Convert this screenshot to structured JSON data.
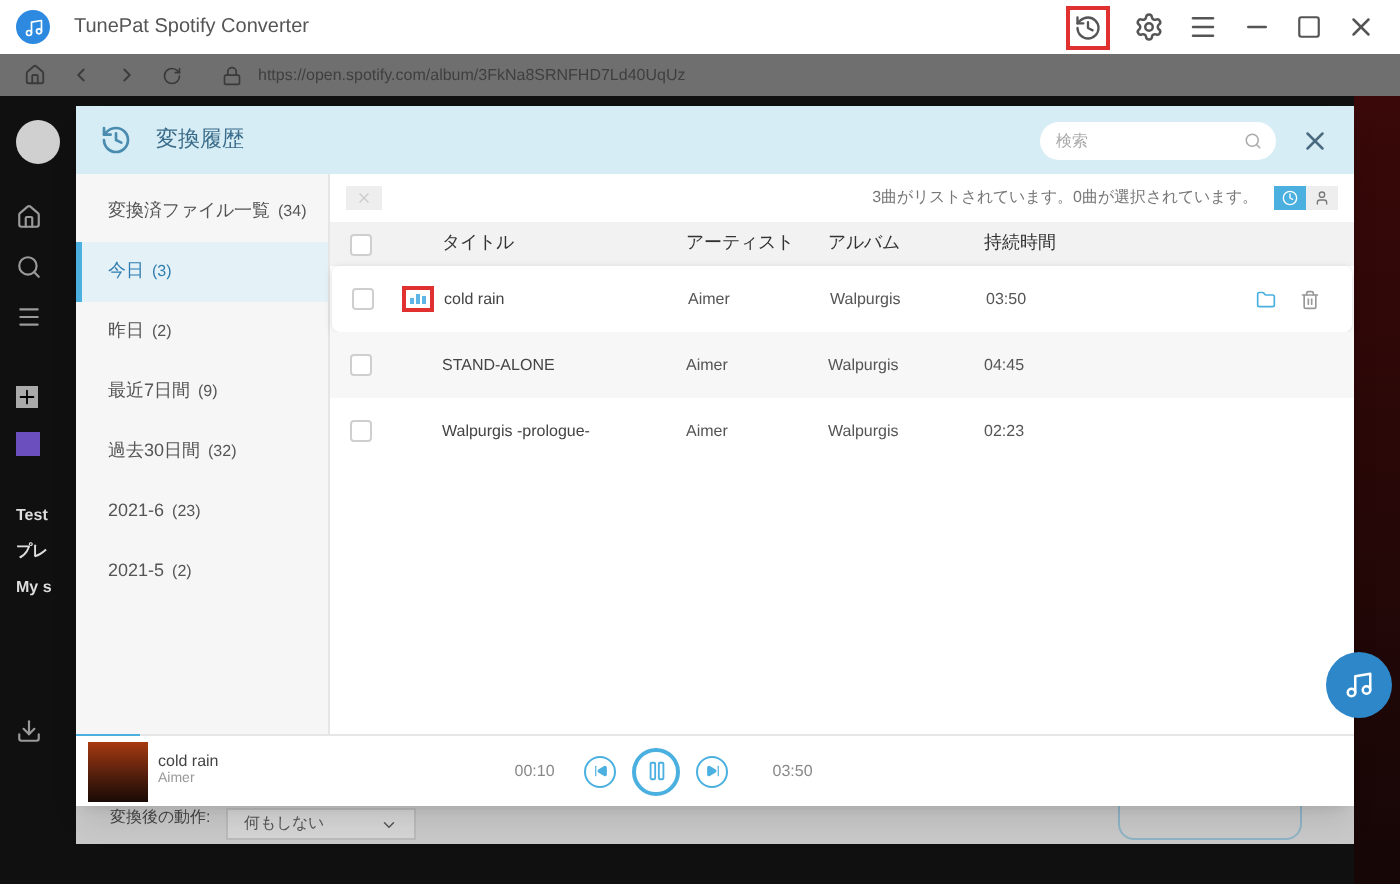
{
  "window": {
    "title": "TunePat Spotify Converter"
  },
  "address_bar": {
    "url": "https://open.spotify.com/album/3FkNa8SRNFHD7Ld40UqUz"
  },
  "background": {
    "sidebar_texts": [
      "Test",
      "プレ",
      "My s"
    ],
    "after_convert_label": "変換後の動作:",
    "after_convert_value": "何もしない"
  },
  "dialog": {
    "title": "変換履歴",
    "search": {
      "placeholder": "検索"
    },
    "sidebar": [
      {
        "label": "変換済ファイル一覧",
        "count": "(34)",
        "selected": false
      },
      {
        "label": "今日",
        "count": "(3)",
        "selected": true
      },
      {
        "label": "昨日",
        "count": "(2)",
        "selected": false
      },
      {
        "label": "最近7日間",
        "count": "(9)",
        "selected": false
      },
      {
        "label": "過去30日間",
        "count": "(32)",
        "selected": false
      },
      {
        "label": "2021-6",
        "count": "(23)",
        "selected": false
      },
      {
        "label": "2021-5",
        "count": "(2)",
        "selected": false
      }
    ],
    "status": "3曲がリストされています。0曲が選択されています。",
    "view_toggles": [
      {
        "kind": "history",
        "selected": true
      },
      {
        "kind": "person",
        "selected": false
      }
    ],
    "table": {
      "select_all": {
        "checked": false
      },
      "columns": [
        "タイトル",
        "アーティスト",
        "アルバム",
        "持続時間"
      ],
      "rows": [
        {
          "title": "cold rain",
          "artist": "Aimer",
          "album": "Walpurgis",
          "duration": "03:50",
          "checked": false,
          "playing": true,
          "hovered": true
        },
        {
          "title": "STAND-ALONE",
          "artist": "Aimer",
          "album": "Walpurgis",
          "duration": "04:45",
          "checked": false,
          "playing": false,
          "hovered": false
        },
        {
          "title": "Walpurgis -prologue-",
          "artist": "Aimer",
          "album": "Walpurgis",
          "duration": "02:23",
          "checked": false,
          "playing": false,
          "hovered": false
        }
      ]
    },
    "player": {
      "title": "cold rain",
      "artist": "Aimer",
      "elapsed": "00:10",
      "total": "03:50",
      "level": 0.05,
      "playing": true
    }
  }
}
